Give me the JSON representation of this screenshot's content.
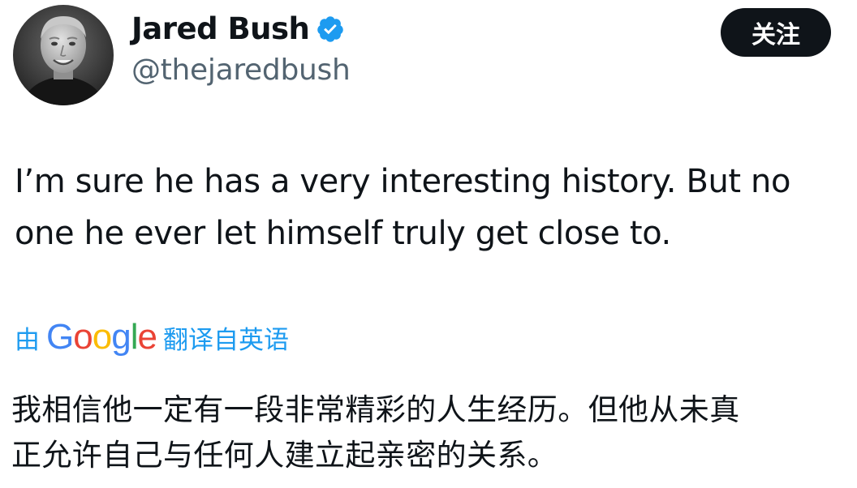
{
  "user": {
    "display_name": "Jared Bush",
    "handle": "@thejaredbush",
    "verified_icon": "verified-badge-icon",
    "avatar": "profile-photo"
  },
  "follow_button": {
    "label": "关注"
  },
  "tweet": {
    "text_line1": "I’m sure he has a very interesting history. But no",
    "text_line2": "one he ever let himself truly get close to."
  },
  "translation": {
    "prefix": "由",
    "provider_logo_text": "Google",
    "suffix": "翻译自英语",
    "text_line1": "我相信他一定有一段非常精彩的人生经历。但他从未真",
    "text_line2": "正允许自己与任何人建立起亲密的关系。"
  },
  "colors": {
    "link_blue": "#1d9bf0",
    "follow_button_bg": "#0f1419",
    "handle_gray": "#536471"
  }
}
